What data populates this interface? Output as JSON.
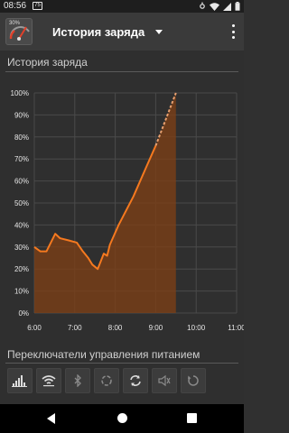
{
  "status_bar": {
    "time": "08:56",
    "badge": "75",
    "icons": [
      "notification-icon",
      "wifi-icon",
      "signal-icon",
      "battery-icon"
    ]
  },
  "toolbar": {
    "app_icon_text": "30%",
    "title": "История заряда"
  },
  "sections": {
    "history": "История заряда",
    "toggles": "Переключатели управления питанием"
  },
  "colors": {
    "accent": "#f5791f",
    "fill": "#7a3e16",
    "background": "#2f2f2f"
  },
  "chart_data": {
    "type": "line",
    "x_tick_labels": [
      "6:00",
      "7:00",
      "8:00",
      "9:00",
      "10:00",
      "11:00"
    ],
    "y_tick_labels": [
      "0%",
      "10%",
      "20%",
      "30%",
      "40%",
      "50%",
      "60%",
      "70%",
      "80%",
      "90%",
      "100%"
    ],
    "xlim": [
      "6:00",
      "11:00"
    ],
    "ylim": [
      0,
      100
    ],
    "grid": true,
    "series": [
      {
        "style": "solid",
        "points": [
          {
            "x": "6:00",
            "y": 30
          },
          {
            "x": "6:09",
            "y": 28
          },
          {
            "x": "6:18",
            "y": 28
          },
          {
            "x": "6:31",
            "y": 36
          },
          {
            "x": "6:38",
            "y": 34
          },
          {
            "x": "6:51",
            "y": 33
          },
          {
            "x": "7:03",
            "y": 32
          },
          {
            "x": "7:12",
            "y": 28
          },
          {
            "x": "7:20",
            "y": 25
          },
          {
            "x": "7:26",
            "y": 22
          },
          {
            "x": "7:34",
            "y": 20
          },
          {
            "x": "7:43",
            "y": 27
          },
          {
            "x": "7:48",
            "y": 26
          },
          {
            "x": "7:52",
            "y": 31
          },
          {
            "x": "8:05",
            "y": 40
          },
          {
            "x": "8:27",
            "y": 53
          },
          {
            "x": "8:47",
            "y": 67
          },
          {
            "x": "9:00",
            "y": 76
          }
        ]
      },
      {
        "style": "dashed",
        "points": [
          {
            "x": "9:00",
            "y": 76
          },
          {
            "x": "9:30",
            "y": 100
          }
        ]
      }
    ]
  },
  "power_toggles": [
    {
      "name": "brightness-icon",
      "state": "on"
    },
    {
      "name": "wifi-icon",
      "state": "on"
    },
    {
      "name": "bluetooth-icon",
      "state": "off"
    },
    {
      "name": "sync-icon",
      "state": "off"
    },
    {
      "name": "auto-rotate-icon",
      "state": "on"
    },
    {
      "name": "sound-icon",
      "state": "off"
    },
    {
      "name": "screen-timeout-icon",
      "state": "off"
    }
  ]
}
